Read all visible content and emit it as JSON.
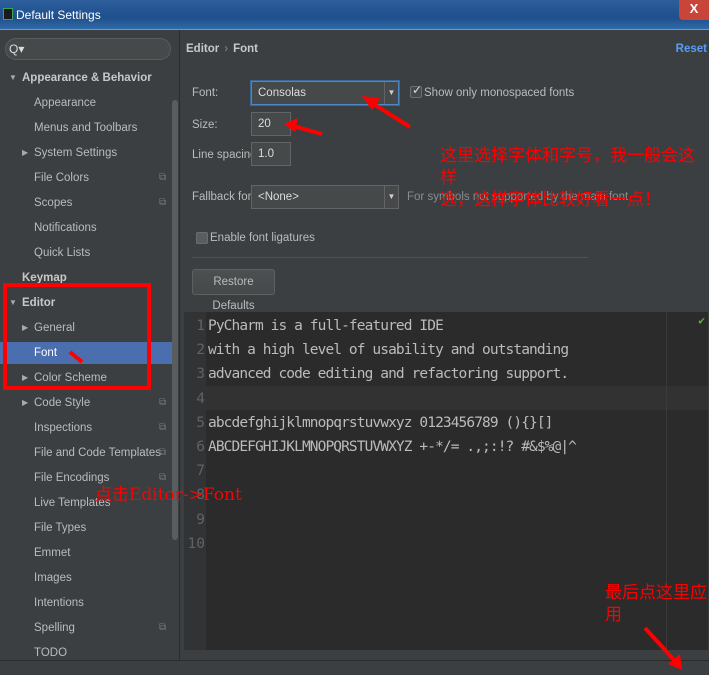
{
  "window": {
    "title": "Default Settings",
    "close_label": "X"
  },
  "sidebar": {
    "search_icon": "Q▾",
    "items": [
      {
        "label": "Appearance & Behavior",
        "level": 0,
        "expanded": true
      },
      {
        "label": "Appearance",
        "level": 1
      },
      {
        "label": "Menus and Toolbars",
        "level": 1
      },
      {
        "label": "System Settings",
        "level": 1,
        "collapsed": true
      },
      {
        "label": "File Colors",
        "level": 1,
        "copy_icon": true
      },
      {
        "label": "Scopes",
        "level": 1,
        "copy_icon": true
      },
      {
        "label": "Notifications",
        "level": 1
      },
      {
        "label": "Quick Lists",
        "level": 1
      },
      {
        "label": "Keymap",
        "level": 0
      },
      {
        "label": "Editor",
        "level": 0,
        "expanded": true
      },
      {
        "label": "General",
        "level": 1,
        "collapsed": true
      },
      {
        "label": "Font",
        "level": 1,
        "selected": true
      },
      {
        "label": "Color Scheme",
        "level": 1,
        "collapsed": true
      },
      {
        "label": "Code Style",
        "level": 1,
        "collapsed": true,
        "copy_icon": true
      },
      {
        "label": "Inspections",
        "level": 1,
        "copy_icon": true
      },
      {
        "label": "File and Code Templates",
        "level": 1,
        "copy_icon": true
      },
      {
        "label": "File Encodings",
        "level": 1,
        "copy_icon": true
      },
      {
        "label": "Live Templates",
        "level": 1
      },
      {
        "label": "File Types",
        "level": 1
      },
      {
        "label": "Emmet",
        "level": 1
      },
      {
        "label": "Images",
        "level": 1
      },
      {
        "label": "Intentions",
        "level": 1
      },
      {
        "label": "Spelling",
        "level": 1,
        "copy_icon": true
      },
      {
        "label": "TODO",
        "level": 1
      }
    ]
  },
  "main": {
    "breadcrumb": [
      "Editor",
      "Font"
    ],
    "breadcrumb_sep": "›",
    "reset_label": "Reset",
    "font_label": "Font:",
    "font_value": "Consolas",
    "monospaced_label": "Show only monospaced fonts",
    "monospaced_checked": true,
    "size_label": "Size:",
    "size_value": "20",
    "line_spacing_label": "Line spacing:",
    "line_spacing_value": "1.0",
    "fallback_label": "Fallback font:",
    "fallback_value": "<None>",
    "fallback_hint": "For symbols not supported by the main font",
    "ligatures_label": "Enable font ligatures",
    "ligatures_checked": false,
    "restore_label": "Restore Defaults"
  },
  "preview": {
    "lines": [
      {
        "n": "1",
        "text": "PyCharm is a full-featured IDE"
      },
      {
        "n": "2",
        "text": "with a high level of usability and outstanding"
      },
      {
        "n": "3",
        "text": "advanced code editing and refactoring support."
      },
      {
        "n": "4",
        "text": ""
      },
      {
        "n": "5",
        "text": "abcdefghijklmnopqrstuvwxyz 0123456789 (){}[]"
      },
      {
        "n": "6",
        "text": "ABCDEFGHIJKLMNOPQRSTUVWXYZ +-*/= .,;:!? #&$%@|^"
      },
      {
        "n": "7",
        "text": ""
      },
      {
        "n": "8",
        "text": ""
      },
      {
        "n": "9",
        "text": ""
      },
      {
        "n": "10",
        "text": ""
      }
    ],
    "status_icon": "✔"
  },
  "annotations": {
    "font_note_line1": "这里选择字体和字号，我一般会这样",
    "font_note_line2": "选，这样字体比较好看一点！",
    "click_note": "点击Editor->Font",
    "apply_note_line1": "最后点这里应",
    "apply_note_line2": "用",
    "color": "#ff0000"
  },
  "colors": {
    "selection": "#4b6eaf",
    "link": "#589df6",
    "editor_bg": "#2b2b2b",
    "panel_bg": "#3c3f41"
  }
}
